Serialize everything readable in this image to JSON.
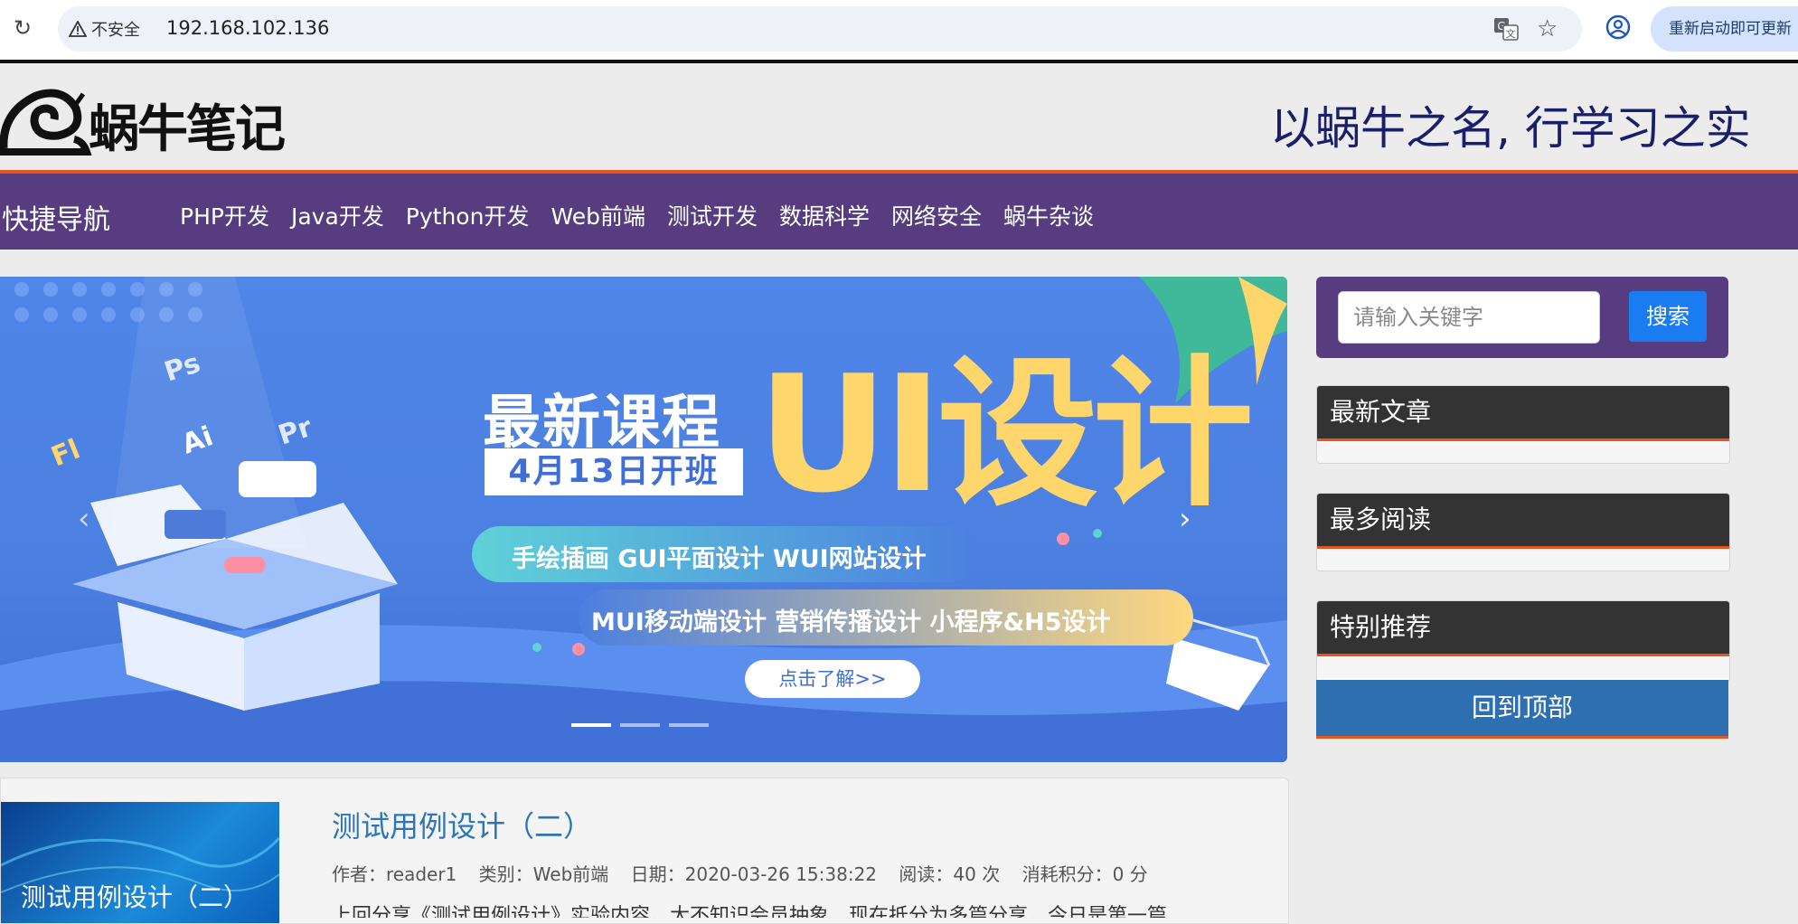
{
  "browser": {
    "security_label": "不安全",
    "url": "192.168.102.136",
    "update_label": "重新启动即可更新"
  },
  "header": {
    "logo_text": "蜗牛笔记",
    "slogan": "以蜗牛之名, 行学习之实"
  },
  "nav": {
    "quick_label": "快捷导航",
    "items": [
      "PHP开发",
      "Java开发",
      "Python开发",
      "Web前端",
      "测试开发",
      "数据科学",
      "网络安全",
      "蜗牛杂谈"
    ]
  },
  "banner": {
    "title": "最新课程",
    "date": "4月13日开班",
    "big_text": "UI设计",
    "tags_row1": "手绘插画   GUI平面设计   WUI网站设计",
    "tags_row2": "MUI移动端设计   营销传播设计   小程序&H5设计",
    "cta": "点击了解>>",
    "icon_labels": [
      "Ps",
      "Fl",
      "Ai",
      "Pr"
    ]
  },
  "article": {
    "thumb_text": "测试用例设计（二）",
    "title": "测试用例设计（二）",
    "author": "作者：reader1",
    "category": "类别：Web前端",
    "date": "日期：2020-03-26 15:38:22",
    "reads": "阅读：40 次",
    "points": "消耗积分：0 分",
    "excerpt": "上回分享《测试用例设计》实验内容，大不知识会员抽象，现在抵分为多篇分享，今日是第一篇"
  },
  "sidebar": {
    "search_placeholder": "请输入关键字",
    "search_button": "搜索",
    "panels": [
      "最新文章",
      "最多阅读",
      "特别推荐"
    ],
    "back_to_top": "回到顶部"
  },
  "colors": {
    "nav_bg": "#573d7f",
    "accent_orange": "#e8541e",
    "banner_blue": "#4f86e7",
    "banner_yellow": "#ffd66b",
    "search_button": "#1a7cf0",
    "back_top_bg": "#2e6fb0",
    "title_link": "#2b75b8"
  },
  "icons": [
    "reload-icon",
    "warning-icon",
    "translate-icon",
    "star-icon",
    "profile-icon",
    "snail-logo-icon",
    "chevron-left-icon",
    "chevron-right-icon"
  ]
}
